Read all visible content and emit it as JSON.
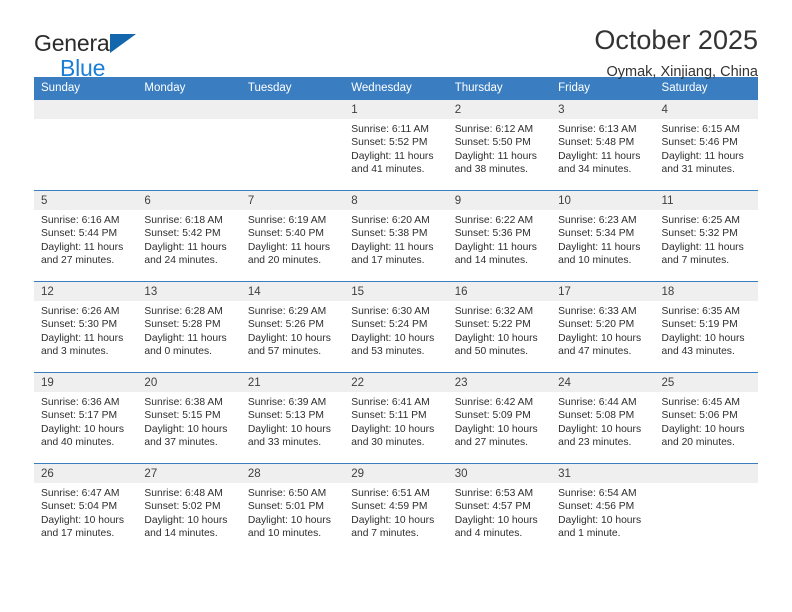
{
  "brand": {
    "line1": "General",
    "line2": "Blue",
    "triangle_icon": "brand-triangle-icon",
    "colors": {
      "general": "#2b2b2b",
      "blue": "#1a7ed6",
      "triangle": "#1466ad"
    }
  },
  "header": {
    "title": "October 2025",
    "subtitle": "Oymak, Xinjiang, China"
  },
  "calendar": {
    "accent_color": "#3a7ec1",
    "daynum_band_color": "#efefef",
    "weekday_headers": [
      "Sunday",
      "Monday",
      "Tuesday",
      "Wednesday",
      "Thursday",
      "Friday",
      "Saturday"
    ],
    "weeks": [
      [
        {
          "day": ""
        },
        {
          "day": ""
        },
        {
          "day": ""
        },
        {
          "day": "1",
          "sunrise": "Sunrise: 6:11 AM",
          "sunset": "Sunset: 5:52 PM",
          "daylight_l1": "Daylight: 11 hours",
          "daylight_l2": "and 41 minutes."
        },
        {
          "day": "2",
          "sunrise": "Sunrise: 6:12 AM",
          "sunset": "Sunset: 5:50 PM",
          "daylight_l1": "Daylight: 11 hours",
          "daylight_l2": "and 38 minutes."
        },
        {
          "day": "3",
          "sunrise": "Sunrise: 6:13 AM",
          "sunset": "Sunset: 5:48 PM",
          "daylight_l1": "Daylight: 11 hours",
          "daylight_l2": "and 34 minutes."
        },
        {
          "day": "4",
          "sunrise": "Sunrise: 6:15 AM",
          "sunset": "Sunset: 5:46 PM",
          "daylight_l1": "Daylight: 11 hours",
          "daylight_l2": "and 31 minutes."
        }
      ],
      [
        {
          "day": "5",
          "sunrise": "Sunrise: 6:16 AM",
          "sunset": "Sunset: 5:44 PM",
          "daylight_l1": "Daylight: 11 hours",
          "daylight_l2": "and 27 minutes."
        },
        {
          "day": "6",
          "sunrise": "Sunrise: 6:18 AM",
          "sunset": "Sunset: 5:42 PM",
          "daylight_l1": "Daylight: 11 hours",
          "daylight_l2": "and 24 minutes."
        },
        {
          "day": "7",
          "sunrise": "Sunrise: 6:19 AM",
          "sunset": "Sunset: 5:40 PM",
          "daylight_l1": "Daylight: 11 hours",
          "daylight_l2": "and 20 minutes."
        },
        {
          "day": "8",
          "sunrise": "Sunrise: 6:20 AM",
          "sunset": "Sunset: 5:38 PM",
          "daylight_l1": "Daylight: 11 hours",
          "daylight_l2": "and 17 minutes."
        },
        {
          "day": "9",
          "sunrise": "Sunrise: 6:22 AM",
          "sunset": "Sunset: 5:36 PM",
          "daylight_l1": "Daylight: 11 hours",
          "daylight_l2": "and 14 minutes."
        },
        {
          "day": "10",
          "sunrise": "Sunrise: 6:23 AM",
          "sunset": "Sunset: 5:34 PM",
          "daylight_l1": "Daylight: 11 hours",
          "daylight_l2": "and 10 minutes."
        },
        {
          "day": "11",
          "sunrise": "Sunrise: 6:25 AM",
          "sunset": "Sunset: 5:32 PM",
          "daylight_l1": "Daylight: 11 hours",
          "daylight_l2": "and 7 minutes."
        }
      ],
      [
        {
          "day": "12",
          "sunrise": "Sunrise: 6:26 AM",
          "sunset": "Sunset: 5:30 PM",
          "daylight_l1": "Daylight: 11 hours",
          "daylight_l2": "and 3 minutes."
        },
        {
          "day": "13",
          "sunrise": "Sunrise: 6:28 AM",
          "sunset": "Sunset: 5:28 PM",
          "daylight_l1": "Daylight: 11 hours",
          "daylight_l2": "and 0 minutes."
        },
        {
          "day": "14",
          "sunrise": "Sunrise: 6:29 AM",
          "sunset": "Sunset: 5:26 PM",
          "daylight_l1": "Daylight: 10 hours",
          "daylight_l2": "and 57 minutes."
        },
        {
          "day": "15",
          "sunrise": "Sunrise: 6:30 AM",
          "sunset": "Sunset: 5:24 PM",
          "daylight_l1": "Daylight: 10 hours",
          "daylight_l2": "and 53 minutes."
        },
        {
          "day": "16",
          "sunrise": "Sunrise: 6:32 AM",
          "sunset": "Sunset: 5:22 PM",
          "daylight_l1": "Daylight: 10 hours",
          "daylight_l2": "and 50 minutes."
        },
        {
          "day": "17",
          "sunrise": "Sunrise: 6:33 AM",
          "sunset": "Sunset: 5:20 PM",
          "daylight_l1": "Daylight: 10 hours",
          "daylight_l2": "and 47 minutes."
        },
        {
          "day": "18",
          "sunrise": "Sunrise: 6:35 AM",
          "sunset": "Sunset: 5:19 PM",
          "daylight_l1": "Daylight: 10 hours",
          "daylight_l2": "and 43 minutes."
        }
      ],
      [
        {
          "day": "19",
          "sunrise": "Sunrise: 6:36 AM",
          "sunset": "Sunset: 5:17 PM",
          "daylight_l1": "Daylight: 10 hours",
          "daylight_l2": "and 40 minutes."
        },
        {
          "day": "20",
          "sunrise": "Sunrise: 6:38 AM",
          "sunset": "Sunset: 5:15 PM",
          "daylight_l1": "Daylight: 10 hours",
          "daylight_l2": "and 37 minutes."
        },
        {
          "day": "21",
          "sunrise": "Sunrise: 6:39 AM",
          "sunset": "Sunset: 5:13 PM",
          "daylight_l1": "Daylight: 10 hours",
          "daylight_l2": "and 33 minutes."
        },
        {
          "day": "22",
          "sunrise": "Sunrise: 6:41 AM",
          "sunset": "Sunset: 5:11 PM",
          "daylight_l1": "Daylight: 10 hours",
          "daylight_l2": "and 30 minutes."
        },
        {
          "day": "23",
          "sunrise": "Sunrise: 6:42 AM",
          "sunset": "Sunset: 5:09 PM",
          "daylight_l1": "Daylight: 10 hours",
          "daylight_l2": "and 27 minutes."
        },
        {
          "day": "24",
          "sunrise": "Sunrise: 6:44 AM",
          "sunset": "Sunset: 5:08 PM",
          "daylight_l1": "Daylight: 10 hours",
          "daylight_l2": "and 23 minutes."
        },
        {
          "day": "25",
          "sunrise": "Sunrise: 6:45 AM",
          "sunset": "Sunset: 5:06 PM",
          "daylight_l1": "Daylight: 10 hours",
          "daylight_l2": "and 20 minutes."
        }
      ],
      [
        {
          "day": "26",
          "sunrise": "Sunrise: 6:47 AM",
          "sunset": "Sunset: 5:04 PM",
          "daylight_l1": "Daylight: 10 hours",
          "daylight_l2": "and 17 minutes."
        },
        {
          "day": "27",
          "sunrise": "Sunrise: 6:48 AM",
          "sunset": "Sunset: 5:02 PM",
          "daylight_l1": "Daylight: 10 hours",
          "daylight_l2": "and 14 minutes."
        },
        {
          "day": "28",
          "sunrise": "Sunrise: 6:50 AM",
          "sunset": "Sunset: 5:01 PM",
          "daylight_l1": "Daylight: 10 hours",
          "daylight_l2": "and 10 minutes."
        },
        {
          "day": "29",
          "sunrise": "Sunrise: 6:51 AM",
          "sunset": "Sunset: 4:59 PM",
          "daylight_l1": "Daylight: 10 hours",
          "daylight_l2": "and 7 minutes."
        },
        {
          "day": "30",
          "sunrise": "Sunrise: 6:53 AM",
          "sunset": "Sunset: 4:57 PM",
          "daylight_l1": "Daylight: 10 hours",
          "daylight_l2": "and 4 minutes."
        },
        {
          "day": "31",
          "sunrise": "Sunrise: 6:54 AM",
          "sunset": "Sunset: 4:56 PM",
          "daylight_l1": "Daylight: 10 hours",
          "daylight_l2": "and 1 minute."
        }
      ]
    ]
  }
}
